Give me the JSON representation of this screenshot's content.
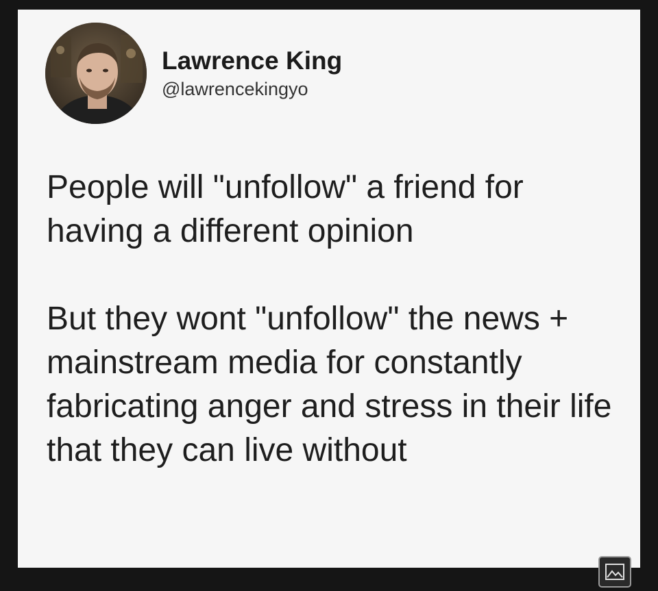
{
  "tweet": {
    "author": {
      "name": "Lawrence King",
      "handle": "@lawrencekingyo"
    },
    "paragraphs": [
      "People will \"unfollow\" a friend for having a different opinion",
      "But they wont \"unfollow\" the news + mainstream media for constantly fabricating anger and stress in their life that they can live without"
    ]
  },
  "colors": {
    "card_background": "#f6f6f6",
    "frame_background": "#151515",
    "text": "#1e1e1e"
  },
  "icons": {
    "avatar": "avatar-photo",
    "badge": "image-icon"
  }
}
